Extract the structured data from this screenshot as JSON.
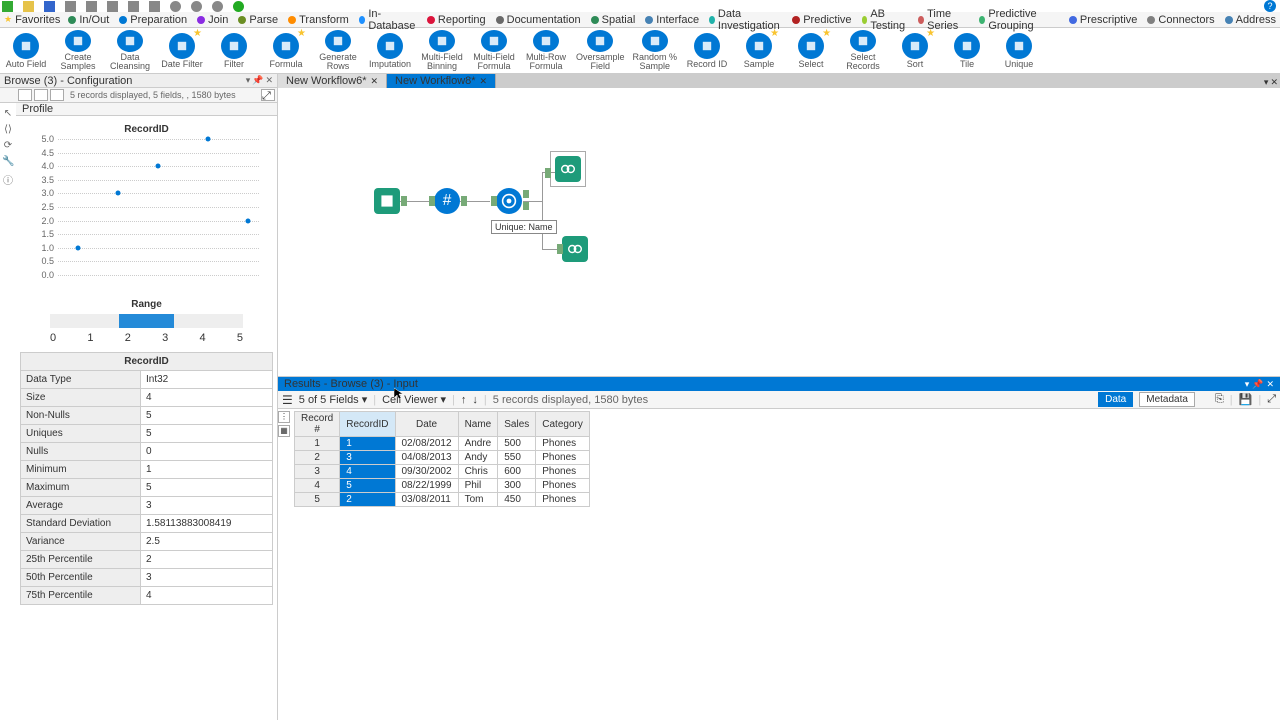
{
  "titlebar_icons": [
    "new",
    "open",
    "save",
    "cut",
    "copy",
    "paste",
    "undo",
    "redo",
    "zoom-out",
    "zoom-fit",
    "zoom-in",
    "run"
  ],
  "favorites_label": "Favorites",
  "categories": [
    {
      "name": "In/Out",
      "color": "#2e8b57"
    },
    {
      "name": "Preparation",
      "color": "#0078d4"
    },
    {
      "name": "Join",
      "color": "#8a2be2"
    },
    {
      "name": "Parse",
      "color": "#6b8e23"
    },
    {
      "name": "Transform",
      "color": "#ff8c00"
    },
    {
      "name": "In-Database",
      "color": "#1e90ff"
    },
    {
      "name": "Reporting",
      "color": "#dc143c"
    },
    {
      "name": "Documentation",
      "color": "#696969"
    },
    {
      "name": "Spatial",
      "color": "#2e8b57"
    },
    {
      "name": "Interface",
      "color": "#4682b4"
    },
    {
      "name": "Data Investigation",
      "color": "#20b2aa"
    },
    {
      "name": "Predictive",
      "color": "#b22222"
    },
    {
      "name": "AB Testing",
      "color": "#9acd32"
    },
    {
      "name": "Time Series",
      "color": "#cd5c5c"
    },
    {
      "name": "Predictive Grouping",
      "color": "#3cb371"
    },
    {
      "name": "Prescriptive",
      "color": "#4169e1"
    },
    {
      "name": "Connectors",
      "color": "#808080"
    },
    {
      "name": "Address",
      "color": "#4682b4"
    }
  ],
  "tools": [
    {
      "label": "Auto Field"
    },
    {
      "label": "Create\nSamples"
    },
    {
      "label": "Data\nCleansing"
    },
    {
      "label": "Date Filter",
      "star": true
    },
    {
      "label": "Filter"
    },
    {
      "label": "Formula",
      "star": true
    },
    {
      "label": "Generate\nRows"
    },
    {
      "label": "Imputation"
    },
    {
      "label": "Multi-Field\nBinning"
    },
    {
      "label": "Multi-Field\nFormula"
    },
    {
      "label": "Multi-Row\nFormula"
    },
    {
      "label": "Oversample\nField"
    },
    {
      "label": "Random %\nSample"
    },
    {
      "label": "Record ID"
    },
    {
      "label": "Sample",
      "star": true
    },
    {
      "label": "Select",
      "star": true
    },
    {
      "label": "Select\nRecords"
    },
    {
      "label": "Sort",
      "star": true
    },
    {
      "label": "Tile"
    },
    {
      "label": "Unique"
    }
  ],
  "config_title": "Browse (3) - Configuration",
  "left_records_status": "5 records displayed, 5 fields, , 1580 bytes",
  "profile_tab": "Profile",
  "chart_data": {
    "type": "scatter",
    "title": "RecordID",
    "ylim": [
      0,
      5
    ],
    "yticks": [
      "5.0",
      "4.5",
      "4.0",
      "3.5",
      "3.0",
      "2.5",
      "2.0",
      "1.5",
      "1.0",
      "0.5",
      "0.0"
    ],
    "points": [
      {
        "x": 0.1,
        "y": 1.0
      },
      {
        "x": 0.3,
        "y": 3.0
      },
      {
        "x": 0.5,
        "y": 4.0
      },
      {
        "x": 0.75,
        "y": 5.0
      },
      {
        "x": 0.95,
        "y": 2.0
      }
    ]
  },
  "range": {
    "label": "Range",
    "min": 0,
    "max": 5,
    "ticks": [
      "0",
      "1",
      "2",
      "3",
      "4",
      "5"
    ],
    "sel_from": 1.8,
    "sel_to": 3.2
  },
  "stats_title": "RecordID",
  "stats": [
    {
      "k": "Data Type",
      "v": "Int32"
    },
    {
      "k": "Size",
      "v": "4"
    },
    {
      "k": "Non-Nulls",
      "v": "5"
    },
    {
      "k": "Uniques",
      "v": "5"
    },
    {
      "k": "Nulls",
      "v": "0"
    },
    {
      "k": "Minimum",
      "v": "1"
    },
    {
      "k": "Maximum",
      "v": "5"
    },
    {
      "k": "Average",
      "v": "3"
    },
    {
      "k": "Standard Deviation",
      "v": "1.58113883008419"
    },
    {
      "k": "Variance",
      "v": "2.5"
    },
    {
      "k": "25th Percentile",
      "v": "2"
    },
    {
      "k": "50th Percentile",
      "v": "3"
    },
    {
      "k": "75th Percentile",
      "v": "4"
    }
  ],
  "workflow_tabs": [
    {
      "label": "New Workflow6*",
      "active": false
    },
    {
      "label": "New Workflow8*",
      "active": true
    }
  ],
  "canvas": {
    "node_label": "Unique: Name"
  },
  "results": {
    "title": "Results - Browse (3) - Input",
    "field_count": "5 of 5 Fields",
    "cell_viewer": "Cell Viewer",
    "status": "5 records displayed, 1580 bytes",
    "data_btn": "Data",
    "metadata_btn": "Metadata",
    "columns": [
      "Record #",
      "RecordID",
      "Date",
      "Name",
      "Sales",
      "Category"
    ],
    "rows": [
      {
        "n": "1",
        "id": "1",
        "date": "02/08/2012",
        "name": "Andre",
        "sales": "500",
        "cat": "Phones"
      },
      {
        "n": "2",
        "id": "3",
        "date": "04/08/2013",
        "name": "Andy",
        "sales": "550",
        "cat": "Phones"
      },
      {
        "n": "3",
        "id": "4",
        "date": "09/30/2002",
        "name": "Chris",
        "sales": "600",
        "cat": "Phones"
      },
      {
        "n": "4",
        "id": "5",
        "date": "08/22/1999",
        "name": "Phil",
        "sales": "300",
        "cat": "Phones"
      },
      {
        "n": "5",
        "id": "2",
        "date": "03/08/2011",
        "name": "Tom",
        "sales": "450",
        "cat": "Phones"
      }
    ]
  }
}
